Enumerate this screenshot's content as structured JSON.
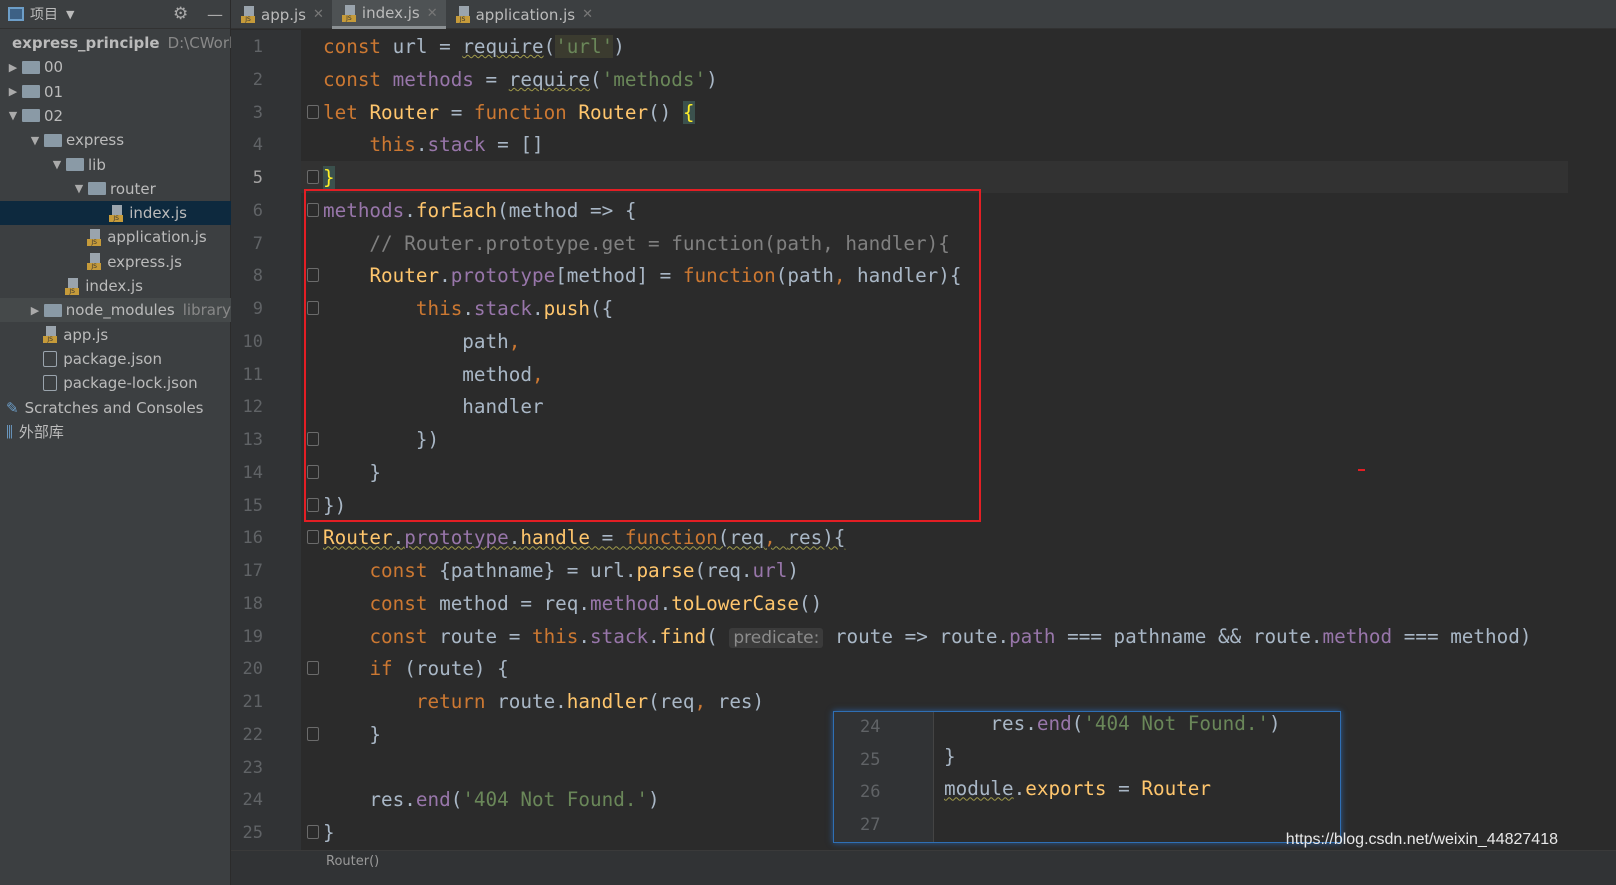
{
  "sidebar": {
    "title": "项目",
    "tree": [
      {
        "label": "express_principle",
        "extra": "D:\\CWork",
        "kind": "folder",
        "depth": 0,
        "tri": "",
        "bold": true
      },
      {
        "label": "00",
        "kind": "folder",
        "depth": 0,
        "tri": "▶"
      },
      {
        "label": "01",
        "kind": "folder",
        "depth": 0,
        "tri": "▶"
      },
      {
        "label": "02",
        "kind": "folder",
        "depth": 0,
        "tri": "▼"
      },
      {
        "label": "express",
        "kind": "folder",
        "depth": 1,
        "tri": "▼"
      },
      {
        "label": "lib",
        "kind": "folder",
        "depth": 2,
        "tri": "▼"
      },
      {
        "label": "router",
        "kind": "folder",
        "depth": 3,
        "tri": "▼"
      },
      {
        "label": "index.js",
        "kind": "js",
        "depth": 4.6,
        "tri": "",
        "selected": true
      },
      {
        "label": "application.js",
        "kind": "js",
        "depth": 3.6,
        "tri": ""
      },
      {
        "label": "express.js",
        "kind": "js",
        "depth": 3.6,
        "tri": ""
      },
      {
        "label": "index.js",
        "kind": "js",
        "depth": 2.6,
        "tri": ""
      },
      {
        "label": "node_modules",
        "extra": "library",
        "kind": "folder",
        "depth": 1,
        "tri": "▶",
        "lib": true
      },
      {
        "label": "app.js",
        "kind": "js",
        "depth": 1.6,
        "tri": ""
      },
      {
        "label": "package.json",
        "kind": "json",
        "depth": 1.6,
        "tri": ""
      },
      {
        "label": "package-lock.json",
        "kind": "json",
        "depth": 1.6,
        "tri": ""
      },
      {
        "label": "Scratches and Consoles",
        "kind": "scratch",
        "depth": 0,
        "tri": ""
      },
      {
        "label": "外部库",
        "kind": "lib",
        "depth": 0,
        "tri": ""
      }
    ]
  },
  "tabs": [
    {
      "label": "app.js"
    },
    {
      "label": "index.js",
      "active": true
    },
    {
      "label": "application.js"
    }
  ],
  "editor": {
    "current_line": 5,
    "lines": [
      [
        [
          "const ",
          "kw"
        ],
        [
          "url = "
        ],
        [
          "require",
          "ul"
        ],
        [
          "("
        ],
        [
          "'url'",
          "st hl"
        ],
        [
          ")"
        ]
      ],
      [
        [
          "const ",
          "kw"
        ],
        [
          "methods",
          "pr"
        ],
        [
          " = "
        ],
        [
          "require",
          "ul"
        ],
        [
          "("
        ],
        [
          "'methods'",
          "st"
        ],
        [
          ")"
        ]
      ],
      [
        [
          "let ",
          "kw"
        ],
        [
          "Router",
          "fn"
        ],
        [
          " = "
        ],
        [
          "function ",
          "kw"
        ],
        [
          "Router",
          "fn"
        ],
        [
          "() "
        ],
        [
          "{",
          "br"
        ]
      ],
      [
        [
          "    "
        ],
        [
          "this",
          "kw"
        ],
        [
          "."
        ],
        [
          "stack",
          "pr"
        ],
        [
          " = []"
        ]
      ],
      [
        [
          "}",
          "br"
        ]
      ],
      [
        [
          "methods",
          "pr"
        ],
        [
          "."
        ],
        [
          "forEach",
          "fn"
        ],
        [
          "(method => {"
        ]
      ],
      [
        [
          "    // Router.prototype.get = function(path, handler){",
          "cm"
        ]
      ],
      [
        [
          "    "
        ],
        [
          "Router",
          "fn"
        ],
        [
          "."
        ],
        [
          "prototype",
          "pr"
        ],
        [
          "[method] = "
        ],
        [
          "function",
          "kw"
        ],
        [
          "(path"
        ],
        [
          ", ",
          "kw"
        ],
        [
          "handler){"
        ]
      ],
      [
        [
          "        "
        ],
        [
          "this",
          "kw"
        ],
        [
          "."
        ],
        [
          "stack",
          "pr"
        ],
        [
          "."
        ],
        [
          "push",
          "fn"
        ],
        [
          "({"
        ]
      ],
      [
        [
          "            path"
        ],
        [
          ",",
          "kw"
        ]
      ],
      [
        [
          "            method"
        ],
        [
          ",",
          "kw"
        ]
      ],
      [
        [
          "            handler"
        ]
      ],
      [
        [
          "        })"
        ]
      ],
      [
        [
          "    }"
        ]
      ],
      [
        [
          "})"
        ]
      ],
      [
        [
          "Router",
          "fn ul"
        ],
        [
          ".",
          "ul"
        ],
        [
          "prototype",
          "pr ul"
        ],
        [
          ".",
          "ul"
        ],
        [
          "handle",
          "fn ul"
        ],
        [
          " = ",
          "ul"
        ],
        [
          "function",
          "kw ul"
        ],
        [
          "(req",
          "ul"
        ],
        [
          ", ",
          "kw ul"
        ],
        [
          "res){",
          "ul"
        ]
      ],
      [
        [
          "    "
        ],
        [
          "const ",
          "kw"
        ],
        [
          "{pathname} = url."
        ],
        [
          "parse",
          "fn"
        ],
        [
          "(req."
        ],
        [
          "url",
          "pr"
        ],
        [
          ")"
        ]
      ],
      [
        [
          "    "
        ],
        [
          "const ",
          "kw"
        ],
        [
          "method = req."
        ],
        [
          "method",
          "pr"
        ],
        [
          "."
        ],
        [
          "toLowerCase",
          "fn"
        ],
        [
          "()"
        ]
      ],
      [
        [
          "    "
        ],
        [
          "const ",
          "kw"
        ],
        [
          "route = "
        ],
        [
          "this",
          "kw"
        ],
        [
          "."
        ],
        [
          "stack",
          "pr"
        ],
        [
          "."
        ],
        [
          "find",
          "fn"
        ],
        [
          "( "
        ],
        [
          "predicate:",
          "hint"
        ],
        [
          " route => route."
        ],
        [
          "path",
          "pr"
        ],
        [
          " === pathname && route."
        ],
        [
          "method",
          "pr"
        ],
        [
          " === method)"
        ]
      ],
      [
        [
          "    "
        ],
        [
          "if ",
          "kw"
        ],
        [
          "(route) {"
        ]
      ],
      [
        [
          "        "
        ],
        [
          "return ",
          "kw"
        ],
        [
          "route."
        ],
        [
          "handler",
          "fn"
        ],
        [
          "(req"
        ],
        [
          ", ",
          "kw"
        ],
        [
          "res)"
        ]
      ],
      [
        [
          "    }"
        ]
      ],
      [
        [
          ""
        ]
      ],
      [
        [
          "    res."
        ],
        [
          "end",
          "pr"
        ],
        [
          "("
        ],
        [
          "'404 Not Found.'",
          "st"
        ],
        [
          ")"
        ]
      ],
      [
        [
          "}"
        ]
      ]
    ]
  },
  "popup": {
    "lines": [
      {
        "n": "24",
        "t": [
          [
            "    res."
          ],
          [
            "end",
            "pr"
          ],
          [
            "("
          ],
          [
            "'404 Not Found.'",
            "st"
          ],
          [
            ")"
          ]
        ]
      },
      {
        "n": "25",
        "t": [
          [
            "}"
          ]
        ]
      },
      {
        "n": "26",
        "t": [
          [
            "module",
            "ul"
          ],
          [
            "."
          ],
          [
            "exports",
            "fn"
          ],
          [
            " = "
          ],
          [
            "Router",
            "fn"
          ]
        ]
      },
      {
        "n": "27",
        "t": [
          [
            ""
          ]
        ]
      }
    ]
  },
  "breadcrumb": "Router()",
  "watermark": "https://blog.csdn.net/weixin_44827418"
}
